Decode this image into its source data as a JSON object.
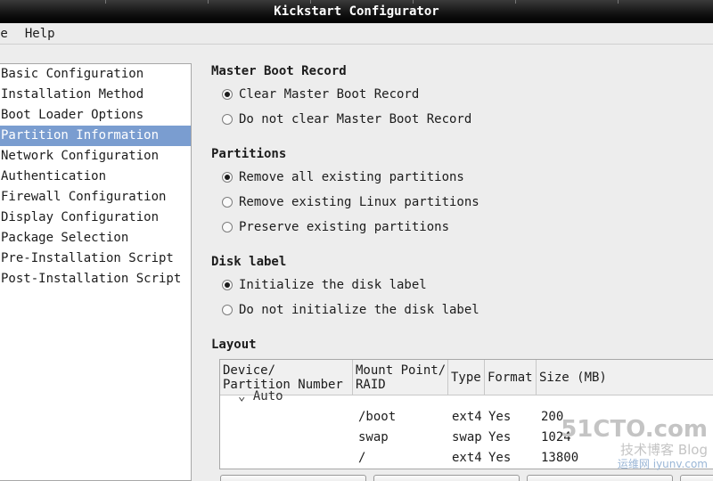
{
  "window": {
    "title": "Kickstart Configurator"
  },
  "menubar": {
    "items": [
      "le",
      "Help"
    ]
  },
  "sidebar": {
    "items": [
      {
        "label": "Basic Configuration",
        "selected": false
      },
      {
        "label": "Installation Method",
        "selected": false
      },
      {
        "label": "Boot Loader Options",
        "selected": false
      },
      {
        "label": "Partition Information",
        "selected": true
      },
      {
        "label": "Network Configuration",
        "selected": false
      },
      {
        "label": "Authentication",
        "selected": false
      },
      {
        "label": "Firewall Configuration",
        "selected": false
      },
      {
        "label": "Display Configuration",
        "selected": false
      },
      {
        "label": "Package Selection",
        "selected": false
      },
      {
        "label": "Pre-Installation Script",
        "selected": false
      },
      {
        "label": "Post-Installation Script",
        "selected": false
      }
    ]
  },
  "mbr": {
    "title": "Master Boot Record",
    "options": [
      {
        "label": "Clear Master Boot Record",
        "checked": true
      },
      {
        "label": "Do not clear Master Boot Record",
        "checked": false
      }
    ]
  },
  "partitions": {
    "title": "Partitions",
    "options": [
      {
        "label": "Remove all existing partitions",
        "checked": true
      },
      {
        "label": "Remove existing Linux partitions",
        "checked": false
      },
      {
        "label": "Preserve existing partitions",
        "checked": false
      }
    ]
  },
  "disk_label": {
    "title": "Disk label",
    "options": [
      {
        "label": "Initialize the disk label",
        "checked": true
      },
      {
        "label": "Do not initialize the disk label",
        "checked": false
      }
    ]
  },
  "layout": {
    "title": "Layout",
    "columns": {
      "device": [
        "Device/",
        "Partition Number"
      ],
      "mount": [
        "Mount Point/",
        "RAID"
      ],
      "type": "Type",
      "format": "Format",
      "size": "Size (MB)"
    },
    "auto_label": "Auto",
    "rows": [
      {
        "mount": "/boot",
        "type": "ext4",
        "format": "Yes",
        "size": "200"
      },
      {
        "mount": "swap",
        "type": "swap",
        "format": "Yes",
        "size": "1024"
      },
      {
        "mount": "/",
        "type": "ext4",
        "format": "Yes",
        "size": "13800"
      }
    ]
  },
  "watermark": {
    "line1": "51CTO.com",
    "line2": "技术博客",
    "line3": "Blog",
    "line4": "运维网",
    "line5": "iyunv.com"
  },
  "colors": {
    "selection": "#7a9dd0",
    "titlebar": "#000000",
    "watermark": "#b9b9b9"
  }
}
